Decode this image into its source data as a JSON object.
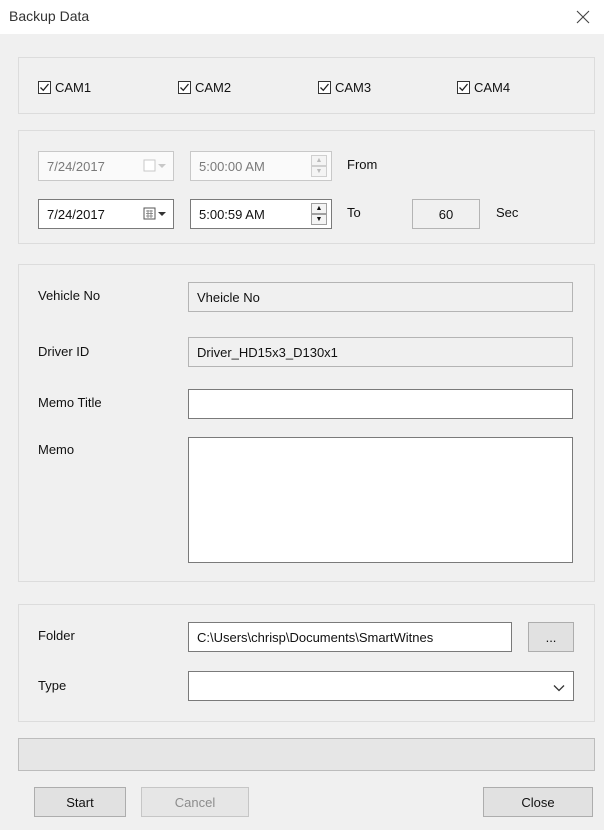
{
  "window": {
    "title": "Backup Data"
  },
  "cameras": [
    {
      "label": "CAM1",
      "checked": true
    },
    {
      "label": "CAM2",
      "checked": true
    },
    {
      "label": "CAM3",
      "checked": true
    },
    {
      "label": "CAM4",
      "checked": true
    }
  ],
  "time": {
    "from_date": "7/24/2017",
    "from_time": "5:00:00 AM",
    "from_label": "From",
    "to_date": "7/24/2017",
    "to_time": "5:00:59 AM",
    "to_label": "To",
    "duration": "60",
    "duration_unit": "Sec"
  },
  "info": {
    "vehicle_label": "Vehicle No",
    "vehicle_value": "Vheicle No",
    "driver_label": "Driver ID",
    "driver_value": "Driver_HD15x3_D130x1",
    "memo_title_label": "Memo Title",
    "memo_title_value": "",
    "memo_label": "Memo",
    "memo_value": ""
  },
  "output": {
    "folder_label": "Folder",
    "folder_value": "C:\\Users\\chrisp\\Documents\\SmartWitnes",
    "browse_label": "...",
    "type_label": "Type",
    "type_value": ""
  },
  "progress": {
    "value": 0
  },
  "buttons": {
    "start": "Start",
    "cancel": "Cancel",
    "close": "Close"
  },
  "colors": {
    "window_bg": "#f0f0f0",
    "border": "#dcdcdc",
    "input_border": "#7a7a7a"
  }
}
